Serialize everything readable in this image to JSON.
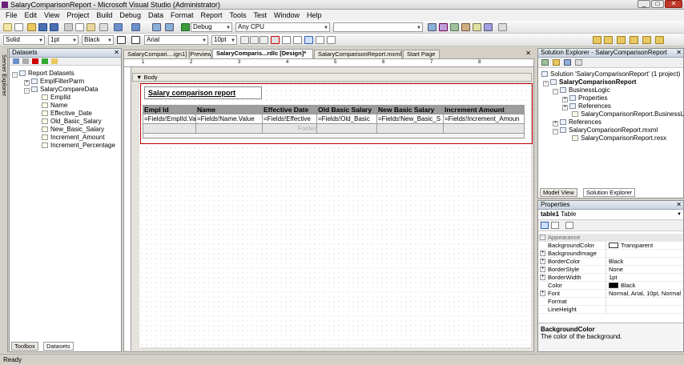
{
  "window": {
    "title": "SalaryComparisonReport - Microsoft Visual Studio (Administrator)",
    "min": "_",
    "max": "□",
    "close": "✕"
  },
  "menu": [
    "File",
    "Edit",
    "View",
    "Project",
    "Build",
    "Debug",
    "Data",
    "Format",
    "Report",
    "Tools",
    "Test",
    "Window",
    "Help"
  ],
  "toolbar": {
    "config": "Debug",
    "platform": "Any CPU",
    "border_style": "Solid",
    "border_width": "1pt",
    "border_color": "Black",
    "font_family": "Arial",
    "font_size": "10pt"
  },
  "datasets_panel": {
    "title": "Datasets",
    "root": "Report Datasets",
    "items": [
      {
        "label": "EmplFilterParm",
        "level": 1,
        "expander": "+"
      },
      {
        "label": "SalaryCompareData",
        "level": 1,
        "expander": "-"
      },
      {
        "label": "EmplId",
        "level": 2
      },
      {
        "label": "Name",
        "level": 2
      },
      {
        "label": "Effective_Date",
        "level": 2
      },
      {
        "label": "Old_Basic_Salary",
        "level": 2
      },
      {
        "label": "New_Basic_Salary",
        "level": 2
      },
      {
        "label": "Increment_Amount",
        "level": 2
      },
      {
        "label": "Increment_Percentage",
        "level": 2
      }
    ],
    "bottom_tabs": [
      "Toolbox",
      "Datasets"
    ]
  },
  "side_strip": {
    "label": "Server Explorer"
  },
  "doc_tabs": [
    {
      "label": "SalaryCompari....ign1] [Preview]",
      "active": false
    },
    {
      "label": "SalaryComparis...rdlc [Design]*",
      "active": true
    },
    {
      "label": "SalaryComparisonReport.mxml*",
      "active": false
    },
    {
      "label": "Start Page",
      "active": false
    }
  ],
  "designer": {
    "body_label": "Body",
    "ruler_marks": [
      "1",
      "2",
      "3",
      "4",
      "5",
      "6",
      "7",
      "8"
    ],
    "report_title": "Salary comparison report",
    "table": {
      "headers": [
        "Empl Id",
        "Name",
        "Effective Date",
        "Old Basic Salary",
        "New Basic Salary",
        "Increment Amount"
      ],
      "detail": [
        "=Fields!EmplId.Va",
        "=Fields!Name.Value",
        "=Fields!Effective",
        "=Fields!Old_Basic",
        "=Fields!New_Basic_S",
        "=Fields!Increment_Amoun"
      ],
      "footer_label": "Footer"
    }
  },
  "solution_explorer": {
    "title": "Solution Explorer - SalaryComparisonReport",
    "solution": "Solution 'SalaryComparisonReport' (1 project)",
    "project": "SalaryComparisonReport",
    "items": [
      {
        "label": "BusinessLogic",
        "level": 1,
        "expander": "-"
      },
      {
        "label": "Properties",
        "level": 2,
        "expander": "+"
      },
      {
        "label": "References",
        "level": 2,
        "expander": "+"
      },
      {
        "label": "SalaryComparisonReport.BusinessLogic.cs",
        "level": 2
      },
      {
        "label": "References",
        "level": 1,
        "expander": "+"
      },
      {
        "label": "SalaryComparisonReport.mxml",
        "level": 1,
        "expander": "-"
      },
      {
        "label": "SalaryComparisonReport.resx",
        "level": 2
      }
    ],
    "bottom_tabs": [
      "Model View",
      "Solution Explorer"
    ]
  },
  "properties": {
    "title": "Properties",
    "object": "table1",
    "object_type": "Table",
    "category": "Appearance",
    "rows": [
      {
        "key": "BackgroundColor",
        "value": "Transparent",
        "swatch": "#ffffff"
      },
      {
        "key": "BackgroundImage",
        "value": "",
        "pm": "+"
      },
      {
        "key": "BorderColor",
        "value": "Black",
        "pm": "+"
      },
      {
        "key": "BorderStyle",
        "value": "None",
        "pm": "+"
      },
      {
        "key": "BorderWidth",
        "value": "1pt",
        "pm": "+"
      },
      {
        "key": "Color",
        "value": "Black",
        "swatch": "#000000"
      },
      {
        "key": "Font",
        "value": "Normal, Arial, 10pt, Normal",
        "pm": "+"
      },
      {
        "key": "Format",
        "value": ""
      },
      {
        "key": "LineHeight",
        "value": ""
      }
    ],
    "desc_title": "BackgroundColor",
    "desc_text": "The color of the background."
  },
  "status": {
    "text": "Ready"
  }
}
